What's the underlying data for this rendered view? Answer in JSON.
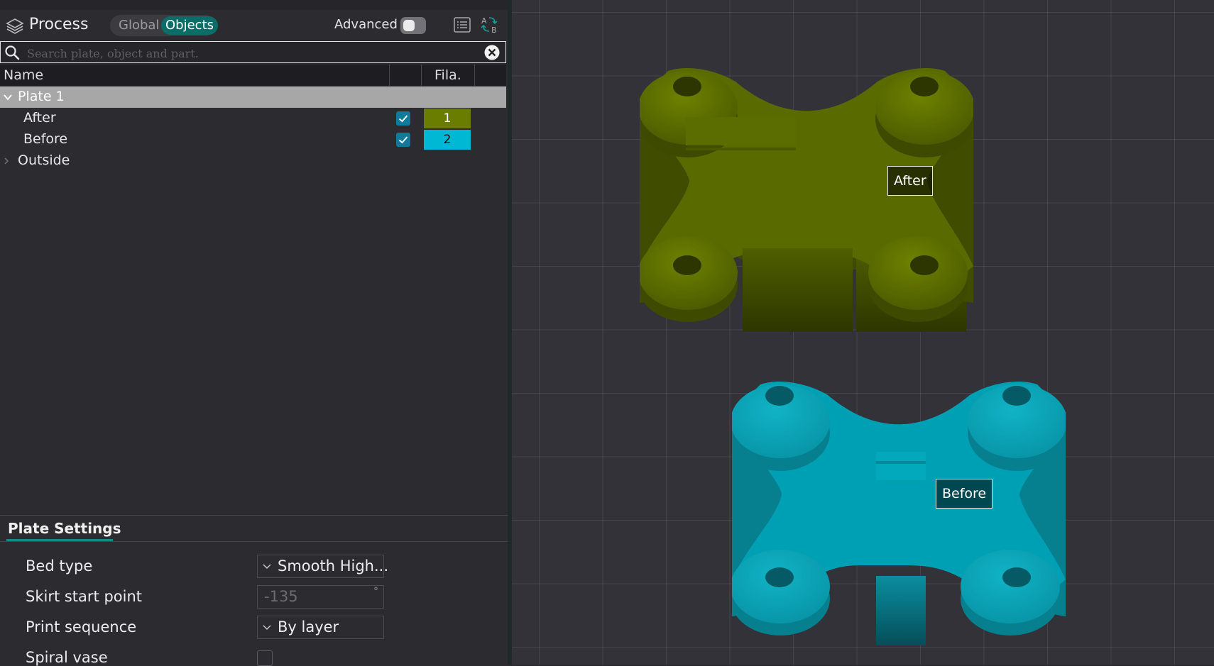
{
  "header": {
    "title": "Process",
    "tabs": [
      "Global",
      "Objects"
    ],
    "active_tab": "Objects",
    "advanced_label": "Advanced",
    "advanced_on": false
  },
  "search": {
    "placeholder": "Search plate, object and part."
  },
  "table": {
    "columns": [
      "Name",
      "",
      "Fila."
    ],
    "plate": {
      "label": "Plate 1",
      "expanded": true
    },
    "objects": [
      {
        "name": "After",
        "visible": true,
        "filament": "1",
        "color": "#6b7d00"
      },
      {
        "name": "Before",
        "visible": true,
        "filament": "2",
        "color": "#00b8d4"
      }
    ],
    "outside": {
      "label": "Outside",
      "expanded": false
    }
  },
  "plate_settings": {
    "title": "Plate Settings",
    "bed_type": {
      "label": "Bed type",
      "value": "Smooth High..."
    },
    "skirt_start": {
      "label": "Skirt start point",
      "value": "-135",
      "unit": "°"
    },
    "print_sequence": {
      "label": "Print sequence",
      "value": "By layer"
    },
    "spiral_vase": {
      "label": "Spiral vase",
      "checked": false
    }
  },
  "viewport": {
    "labels": {
      "after": "After",
      "before": "Before"
    },
    "colors": {
      "after": "#5a6b00",
      "before": "#009fb3"
    }
  }
}
